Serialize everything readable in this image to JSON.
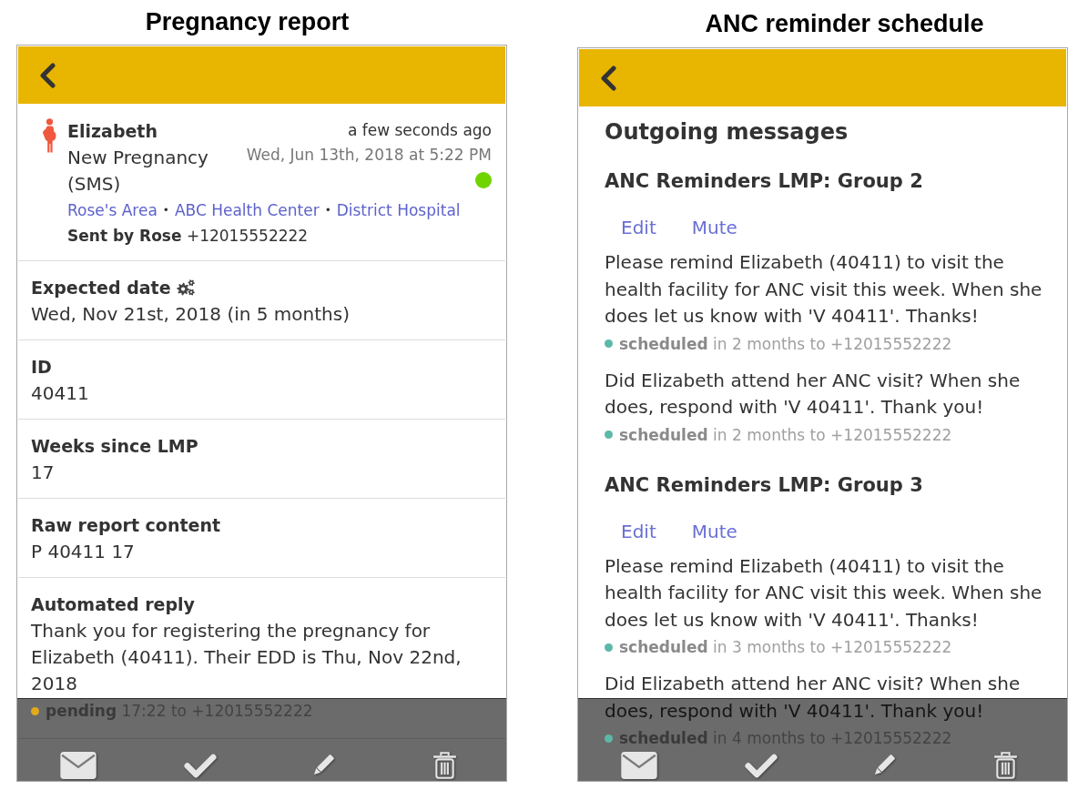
{
  "report_panel": {
    "caption": "Pregnancy report",
    "report": {
      "patient": "Elizabeth",
      "form": "New Pregnancy (SMS)",
      "relative_time": "a few seconds ago",
      "timestamp": "Wed, Jun 13th, 2018 at 5:22 PM",
      "valid": true,
      "places": [
        "Rose's Area",
        "ABC Health Center",
        "District Hospital"
      ],
      "place_separator": "•",
      "sender": "**Sent by Rose** +12015552222"
    },
    "fields": [
      {
        "kind": "text",
        "label": "Expected date",
        "computed": true,
        "value": "Wed, Nov 21st, 2018 (in 5 months)"
      },
      {
        "kind": "text",
        "label": "ID",
        "computed": false,
        "value": "40411"
      },
      {
        "kind": "text",
        "label": "Weeks since LMP",
        "computed": false,
        "value": "17"
      },
      {
        "kind": "text",
        "label": "Raw report content",
        "computed": false,
        "value": "P 40411 17"
      },
      {
        "kind": "message",
        "label": "Automated reply",
        "computed": false,
        "value": "Thank you for registering the pregnancy for Elizabeth (40411). Their EDD is Thu, Nov 22nd, 2018",
        "status": "pending",
        "detail": "17:22 to +12015552222",
        "color": "#e2a91c"
      }
    ]
  },
  "schedule_panel": {
    "caption": "ANC reminder schedule",
    "heading": "Outgoing messages",
    "groups": [
      {
        "title": "ANC Reminders LMP: Group 2",
        "actions": [
          "Edit",
          "Mute"
        ],
        "messages": [
          {
            "text": "Please remind Elizabeth (40411) to visit the health facility for ANC visit this week. When she does let us know with 'V 40411'. Thanks!",
            "status": "scheduled",
            "detail": "in 2 months to +12015552222",
            "color": "#5cb8a8"
          },
          {
            "text": "Did Elizabeth attend her ANC visit? When she does, respond with 'V 40411'. Thank you!",
            "status": "scheduled",
            "detail": "in 2 months to +12015552222",
            "color": "#5cb8a8"
          }
        ]
      },
      {
        "title": "ANC Reminders LMP: Group 3",
        "actions": [
          "Edit",
          "Mute"
        ],
        "messages": [
          {
            "text": "Please remind Elizabeth (40411) to visit the health facility for ANC visit this week. When she does let us know with 'V 40411'. Thanks!",
            "status": "scheduled",
            "detail": "in 3 months to +12015552222",
            "color": "#5cb8a8"
          },
          {
            "text": "Did Elizabeth attend her ANC visit? When she does, respond with 'V 40411'. Thank you!",
            "status": "scheduled",
            "detail": "in 4 months to +12015552222",
            "color": "#5cb8a8"
          }
        ]
      }
    ]
  }
}
